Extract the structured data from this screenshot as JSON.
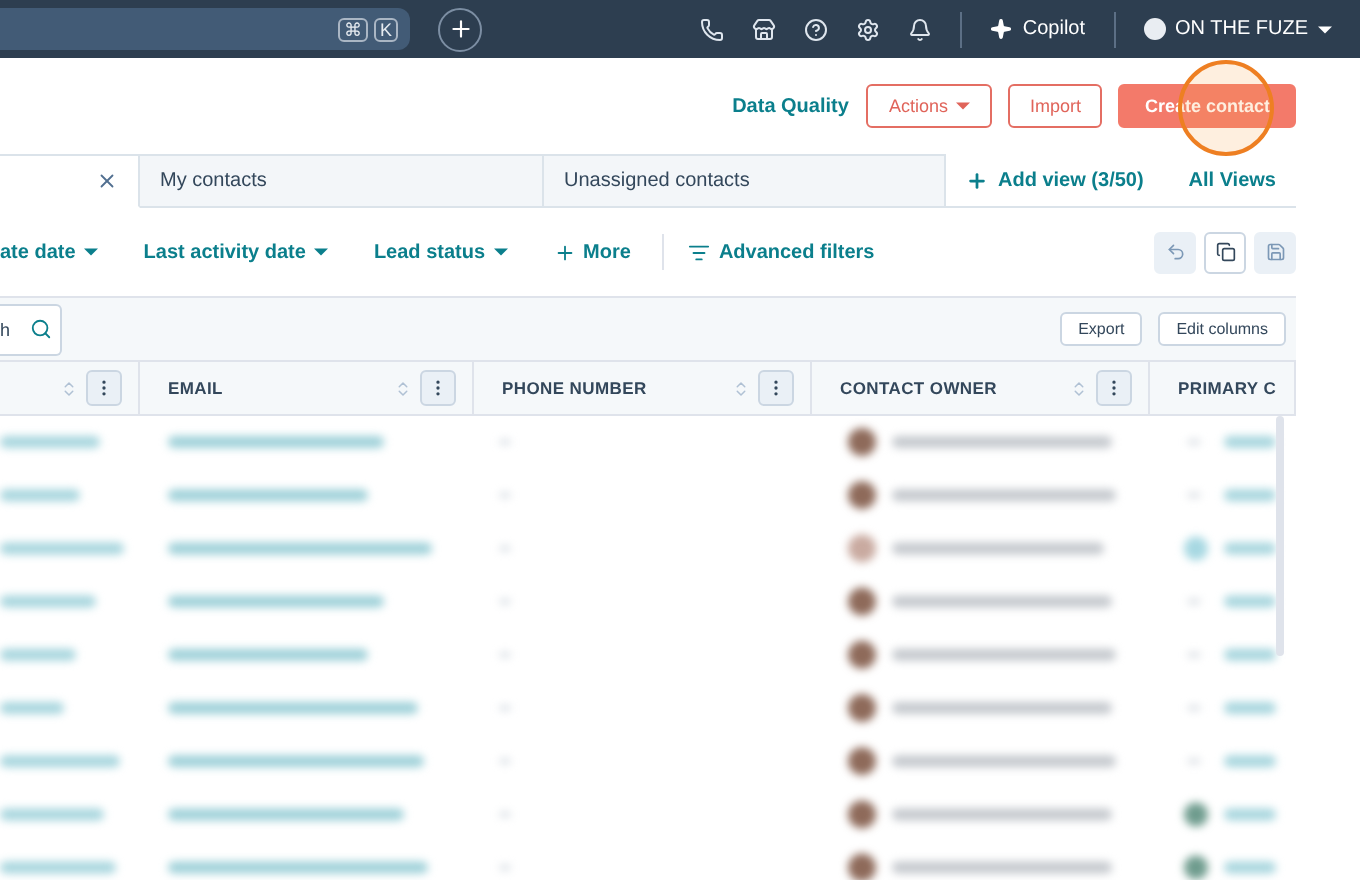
{
  "topbar": {
    "search_keys": [
      "⌘",
      "K"
    ],
    "copilot": "Copilot",
    "account": "ON THE FUZE"
  },
  "actions": {
    "link": "Data Quality",
    "buttons": [
      "Actions",
      "Import"
    ],
    "primary": "Create contact"
  },
  "tabs": [
    {
      "closable": true,
      "selected": true
    },
    {
      "label": "My contacts",
      "selected": false
    },
    {
      "label": "Unassigned contacts",
      "selected": false
    }
  ],
  "add_view": "Add view (3/50)",
  "all_views": "All Views",
  "filters": [
    {
      "label": "ate date",
      "kind": "dropdown"
    },
    {
      "label": "Last activity date",
      "kind": "dropdown"
    },
    {
      "label": "Lead status",
      "kind": "dropdown"
    },
    {
      "label": "More",
      "kind": "add"
    }
  ],
  "advanced_filters": "Advanced filters",
  "table_search": {
    "value": "h"
  },
  "table_buttons": [
    "Export",
    "Edit columns"
  ],
  "columns": [
    {
      "sortable": true
    },
    {
      "label": "EMAIL",
      "sortable": true
    },
    {
      "label": "PHONE NUMBER",
      "sortable": true
    },
    {
      "label": "CONTACT OWNER",
      "sortable": true
    },
    {
      "label": "PRIMARY C",
      "sortable": false
    }
  ]
}
